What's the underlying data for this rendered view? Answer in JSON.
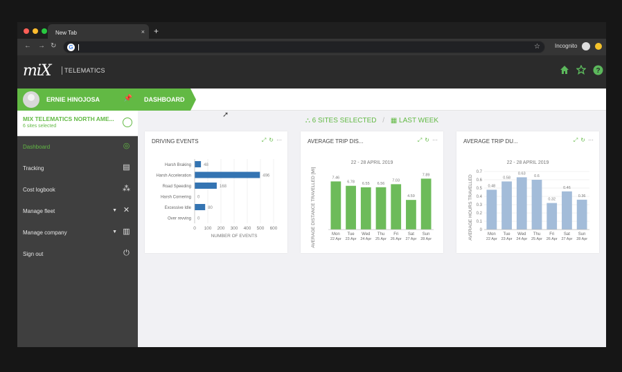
{
  "browser": {
    "tab_title": "New Tab",
    "close_glyph": "×",
    "new_tab_glyph": "+",
    "incognito_label": "Incognito",
    "colors": {
      "close": "#ff5f57",
      "minimize": "#febc2e",
      "maximize": "#28c840"
    }
  },
  "app": {
    "logo": "mix",
    "logo_sub": "TELEMATICS",
    "header_icons": [
      "home-icon",
      "star-icon",
      "help-icon"
    ]
  },
  "sidebar": {
    "user_name": "ERNIE HINOJOSA",
    "org_name": "MIX TELEMATICS NORTH AME...",
    "org_sub": "6 sites selected",
    "items": [
      {
        "label": "Dashboard",
        "icon": "dashboard-icon",
        "active": true
      },
      {
        "label": "Tracking",
        "icon": "map-icon"
      },
      {
        "label": "Cost logbook",
        "icon": "logbook-icon"
      },
      {
        "label": "Manage fleet",
        "icon": "wrench-icon",
        "has_caret": true
      },
      {
        "label": "Manage company",
        "icon": "building-icon",
        "has_caret": true
      },
      {
        "label": "Sign out",
        "icon": "power-icon"
      }
    ]
  },
  "breadcrumb": {
    "label": "DASHBOARD"
  },
  "filter": {
    "sites": "6 SITES SELECTED",
    "divider": "/",
    "period": "LAST WEEK"
  },
  "cards": [
    {
      "title": "DRIVING EVENTS"
    },
    {
      "title": "AVERAGE TRIP DIS...",
      "subtitle": "22 - 28 APRIL 2019"
    },
    {
      "title": "AVERAGE TRIP DU...",
      "subtitle": "22 - 28 APRIL 2019"
    }
  ],
  "chart_data": [
    {
      "type": "bar",
      "orientation": "horizontal",
      "categories": [
        "Harsh Braking",
        "Harsh Acceleration",
        "Road Speeding",
        "Harsh Cornering",
        "Excessive Idle",
        "Over revving"
      ],
      "values": [
        48,
        496,
        168,
        0,
        80,
        0
      ],
      "xlabel": "NUMBER OF EVENTS",
      "xlim": [
        0,
        600
      ],
      "xticks": [
        0,
        100,
        200,
        300,
        400,
        500,
        600
      ],
      "color": "#3474b2"
    },
    {
      "type": "bar",
      "categories": [
        "Mon 22 Apr",
        "Tue 23 Apr",
        "Wed 24 Apr",
        "Thu 25 Apr",
        "Fri 26 Apr",
        "Sat 27 Apr",
        "Sun 28 Apr"
      ],
      "values": [
        7.46,
        6.78,
        6.55,
        6.56,
        7.03,
        4.59,
        7.89
      ],
      "ylabel": "AVERAGE DISTANCE TRAVELLED [MI]",
      "ylim": [
        0,
        9
      ],
      "color": "#6dbb5a"
    },
    {
      "type": "bar",
      "categories": [
        "Mon 22 Apr",
        "Tue 23 Apr",
        "Wed 24 Apr",
        "Thu 25 Apr",
        "Fri 26 Apr",
        "Sat 27 Apr",
        "Sun 28 Apr"
      ],
      "values": [
        0.48,
        0.58,
        0.63,
        0.6,
        0.32,
        0.46,
        0.36
      ],
      "ylabel": "AVERAGE HOURS TRAVELLED",
      "ylim": [
        0,
        0.7
      ],
      "yticks": [
        0,
        0.1,
        0.2,
        0.3,
        0.4,
        0.5,
        0.6,
        0.7
      ],
      "color": "#a3bcd9"
    }
  ]
}
